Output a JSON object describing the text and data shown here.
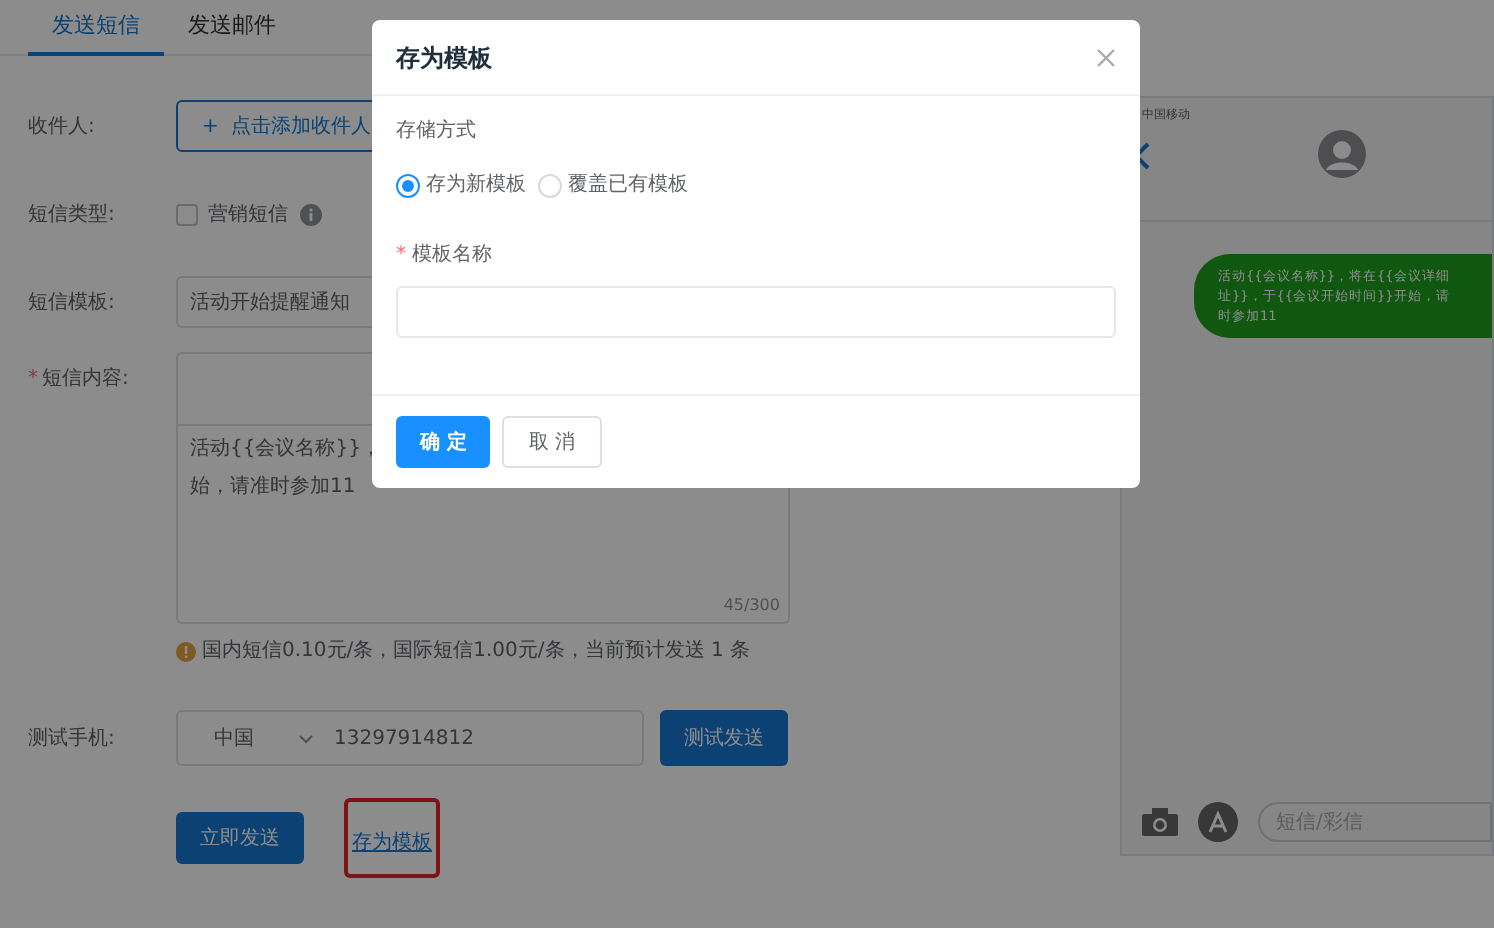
{
  "tabs": [
    {
      "label": "发送短信",
      "selected": true
    },
    {
      "label": "发送邮件",
      "selected": false
    }
  ],
  "form": {
    "recipient_label": "收件人:",
    "recipient_button": "+  点击添加收件人",
    "type_label": "短信类型:",
    "marketing": {
      "label": "营销短信",
      "checked": false
    },
    "template_label": "短信模板:",
    "template_value": "活动开始提醒通知",
    "content_label": "短信内容:",
    "content_mark": "*",
    "content_lines": [
      "活动{{会议名称}}，",
      "始，请准时参加11"
    ],
    "counter": "45/300",
    "cost_note": "国内短信0.10元/条，国际短信1.00元/条，当前预计发送 1 条",
    "phone_label": "测试手机:",
    "country": "中国",
    "phone": "13297914812",
    "test_button": "测试发送",
    "send_button": "立即发送",
    "save_link": "存为模板"
  },
  "preview": {
    "carrier": "中国移动",
    "bubble_lines": [
      "活动{{会议名称}}，将在{{会议详细",
      "址}}，于{{会议开始时间}}开始，请",
      "时参加11"
    ],
    "input_placeholder": "短信/彩信"
  },
  "dialog": {
    "title": "存为模板",
    "storage_label": "存储方式",
    "options": [
      {
        "label": "存为新模板",
        "selected": true
      },
      {
        "label": "覆盖已有模板",
        "selected": false
      }
    ],
    "name_label": "模板名称",
    "name_mark": "*",
    "confirm": "确 定",
    "cancel": "取 消"
  }
}
